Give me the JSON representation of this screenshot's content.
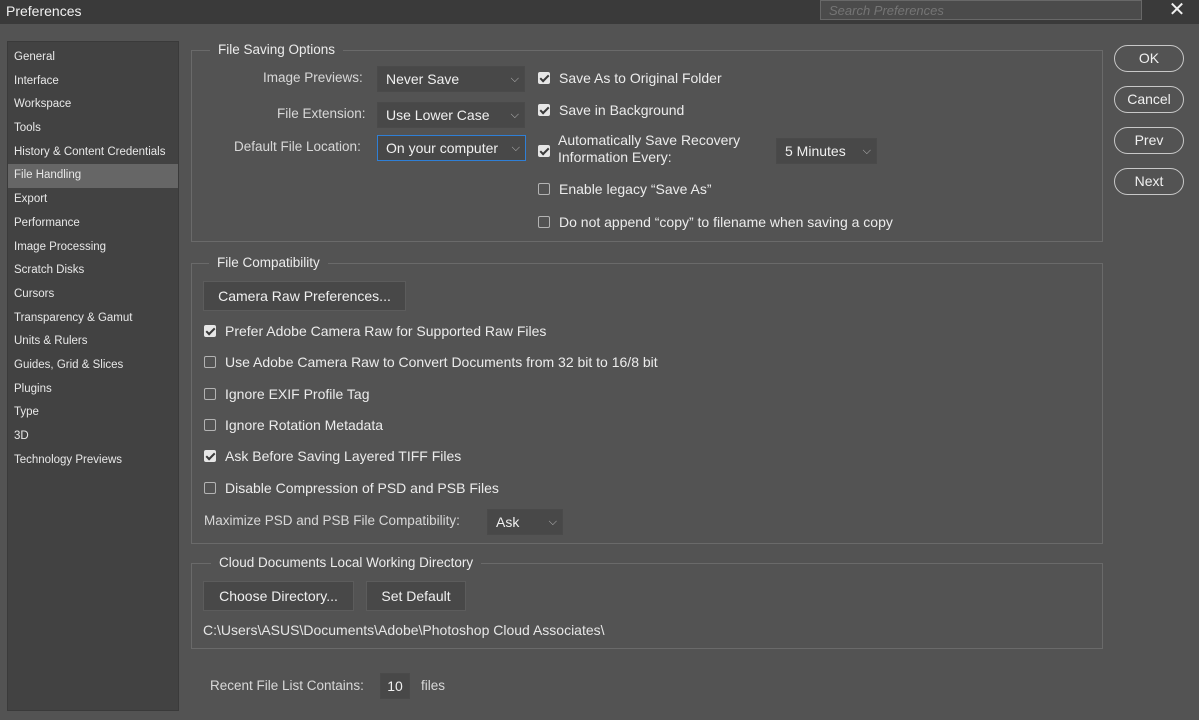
{
  "window": {
    "title": "Preferences",
    "search_placeholder": "Search Preferences",
    "close": "✕"
  },
  "nav": [
    "General",
    "Interface",
    "Workspace",
    "Tools",
    "History & Content Credentials",
    "File Handling",
    "Export",
    "Performance",
    "Image Processing",
    "Scratch Disks",
    "Cursors",
    "Transparency & Gamut",
    "Units & Rulers",
    "Guides, Grid & Slices",
    "Plugins",
    "Type",
    "3D",
    "Technology Previews"
  ],
  "nav_active": "File Handling",
  "buttons": {
    "ok": "OK",
    "cancel": "Cancel",
    "prev": "Prev",
    "next": "Next"
  },
  "file_saving": {
    "legend": "File Saving Options",
    "image_previews_label": "Image Previews:",
    "image_previews_value": "Never Save",
    "file_extension_label": "File Extension:",
    "file_extension_value": "Use Lower Case",
    "default_location_label": "Default File Location:",
    "default_location_value": "On your computer",
    "save_as_original": "Save As to Original Folder",
    "save_in_background": "Save in Background",
    "auto_save_line1": "Automatically Save Recovery",
    "auto_save_line2": "Information Every:",
    "auto_save_interval": "5 Minutes",
    "legacy_save_as": "Enable legacy “Save As”",
    "no_copy_append": "Do not append “copy” to filename when saving a copy"
  },
  "compat": {
    "legend": "File Compatibility",
    "camera_raw_prefs": "Camera Raw Preferences...",
    "prefer_acr": "Prefer Adobe Camera Raw for Supported Raw Files",
    "use_acr_convert": "Use Adobe Camera Raw to Convert Documents from 32 bit to 16/8 bit",
    "ignore_exif": "Ignore EXIF Profile Tag",
    "ignore_rotation": "Ignore Rotation Metadata",
    "ask_tiff": "Ask Before Saving Layered TIFF Files",
    "disable_compression": "Disable Compression of PSD and PSB Files",
    "maximize_label": "Maximize PSD and PSB File Compatibility:",
    "maximize_value": "Ask"
  },
  "cloud": {
    "legend": "Cloud Documents Local Working Directory",
    "choose_directory": "Choose Directory...",
    "set_default": "Set Default",
    "path": "C:\\Users\\ASUS\\Documents\\Adobe\\Photoshop Cloud Associates\\"
  },
  "recent": {
    "label": "Recent File List Contains:",
    "value": "10",
    "unit": "files"
  },
  "checks": {
    "save_as_original": true,
    "save_in_background": true,
    "auto_save": true,
    "legacy_save_as": false,
    "no_copy_append": false,
    "prefer_acr": true,
    "use_acr_convert": false,
    "ignore_exif": false,
    "ignore_rotation": false,
    "ask_tiff": true,
    "disable_compression": false
  }
}
